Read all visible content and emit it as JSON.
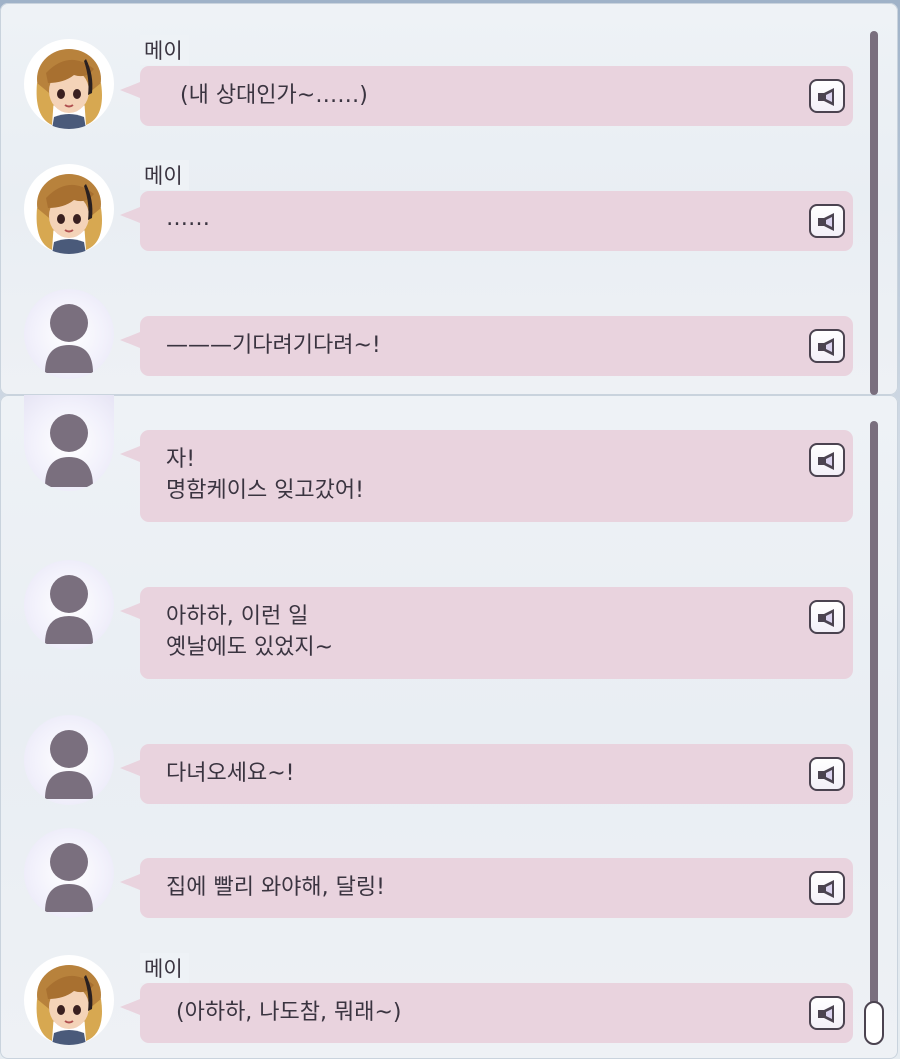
{
  "top_panel": {
    "entries": [
      {
        "speaker": "메이",
        "avatar": "mei-avatar",
        "text": "(내 상대인가~……)"
      },
      {
        "speaker": "메이",
        "avatar": "mei-avatar",
        "text": "……"
      },
      {
        "speaker": "",
        "avatar": "unknown-silhouette",
        "text": "———기다려기다려~!"
      }
    ]
  },
  "bottom_panel": {
    "entries": [
      {
        "speaker": "",
        "avatar": "unknown-silhouette",
        "text": "자!\n명함케이스 잊고갔어!"
      },
      {
        "speaker": "",
        "avatar": "unknown-silhouette",
        "text": "아하하, 이런 일\n옛날에도 있었지~"
      },
      {
        "speaker": "",
        "avatar": "unknown-silhouette",
        "text": "다녀오세요~!"
      },
      {
        "speaker": "",
        "avatar": "unknown-silhouette",
        "text": "집에 빨리 와야해, 달링!"
      },
      {
        "speaker": "메이",
        "avatar": "mei-avatar",
        "text": "(아하하, 나도참, 뭐래~)"
      }
    ]
  },
  "icons": {
    "voice": "speaker-icon",
    "unknown_avatar": "person-silhouette-icon"
  },
  "colors": {
    "bubble": "#e9d3de",
    "text": "#3a3440",
    "silhouette": "#7a6f7e",
    "scrollbar": "#7a6f7e"
  }
}
